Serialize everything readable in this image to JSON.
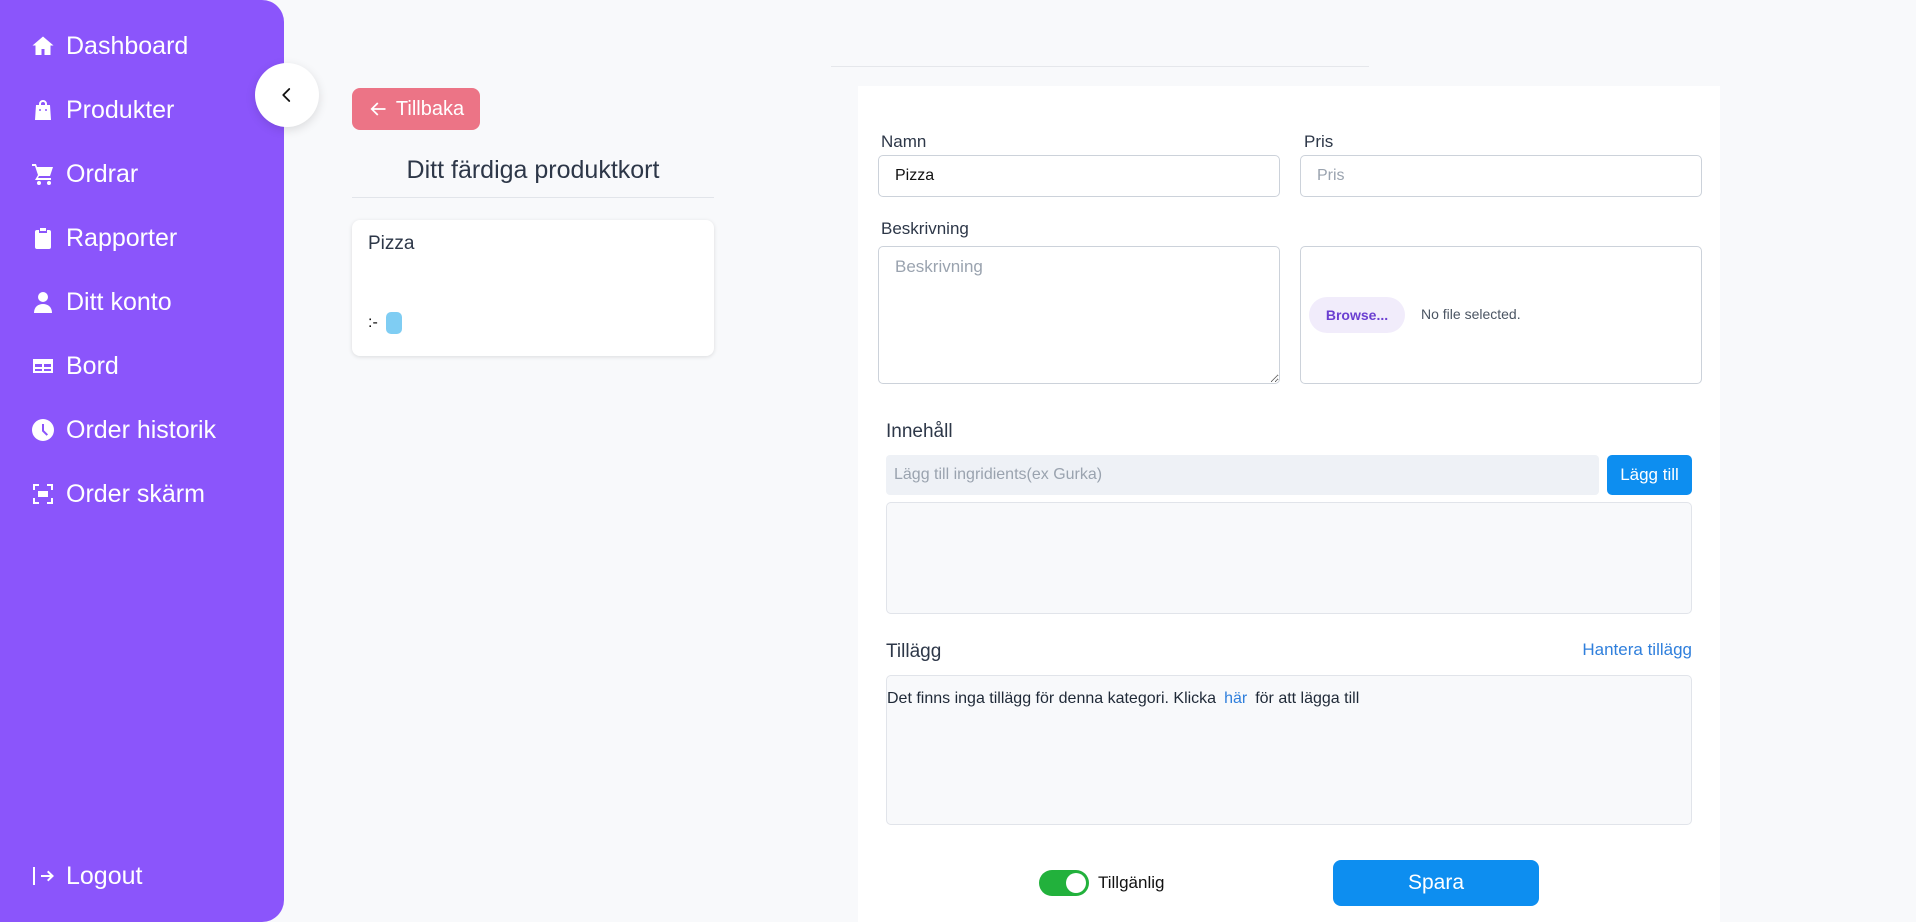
{
  "sidebar": {
    "items": [
      {
        "label": "Dashboard",
        "icon": "home-icon"
      },
      {
        "label": "Produkter",
        "icon": "shopping-bag-icon"
      },
      {
        "label": "Ordrar",
        "icon": "cart-icon"
      },
      {
        "label": "Rapporter",
        "icon": "clipboard-icon"
      },
      {
        "label": "Ditt konto",
        "icon": "user-icon"
      },
      {
        "label": "Bord",
        "icon": "table-icon"
      },
      {
        "label": "Order historik",
        "icon": "clock-icon"
      },
      {
        "label": "Order skärm",
        "icon": "screen-icon"
      }
    ],
    "logout_label": "Logout",
    "color": "#8b55fb"
  },
  "left": {
    "back_label": "Tillbaka",
    "card_heading": "Ditt färdiga produktkort",
    "card": {
      "name": "Pizza",
      "price_prefix": ":-"
    }
  },
  "form": {
    "name_label": "Namn",
    "name_value": "Pizza",
    "price_label": "Pris",
    "price_placeholder": "Pris",
    "desc_label": "Beskrivning",
    "desc_placeholder": "Beskrivning",
    "browse_label": "Browse...",
    "file_status": "No file selected.",
    "ingredients_title": "Innehåll",
    "ingredients_placeholder": "Lägg till ingridients(ex Gurka)",
    "add_label": "Lägg till",
    "addons_title": "Tillägg",
    "manage_addons_label": "Hantera tillägg",
    "empty_addons_before": "Det finns inga tillägg för denna kategori. Klicka",
    "empty_addons_link": "här",
    "empty_addons_after": "för att lägga till",
    "available_label": "Tillgänlig",
    "available": true,
    "save_label": "Spara"
  }
}
